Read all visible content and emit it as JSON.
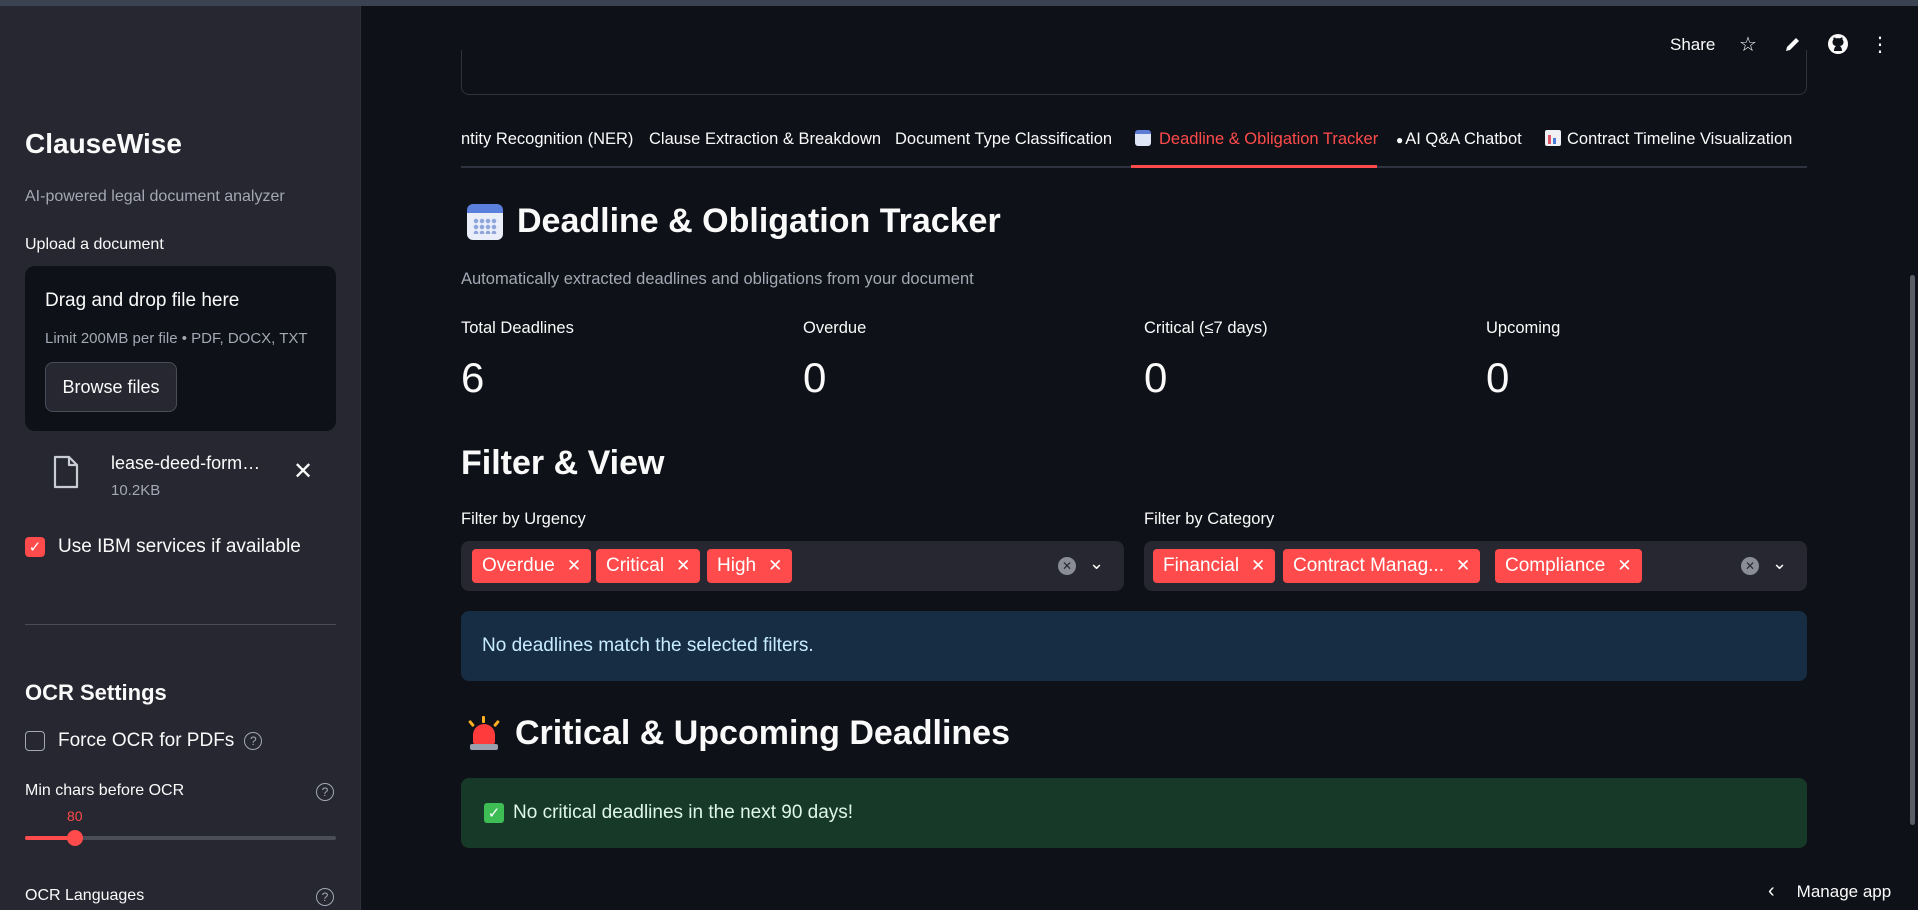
{
  "sidebar": {
    "app_title": "ClauseWise",
    "app_subtitle": "AI-powered legal document analyzer",
    "upload_label": "Upload a document",
    "dropzone": {
      "title": "Drag and drop file here",
      "limit": "Limit 200MB per file • PDF, DOCX, TXT",
      "browse_label": "Browse files"
    },
    "file": {
      "name": "lease-deed-format.docx",
      "size": "10.2KB"
    },
    "ibm_checkbox": {
      "label": "Use IBM services if available",
      "checked": true
    },
    "ocr": {
      "title": "OCR Settings",
      "force_label": "Force OCR for PDFs",
      "force_checked": false,
      "min_chars_label": "Min chars before OCR",
      "min_chars_value": "80",
      "min_chars_fraction": 0.16,
      "languages_label": "OCR Languages"
    }
  },
  "header": {
    "share_label": "Share",
    "icons": [
      "star-icon",
      "edit-icon",
      "github-icon",
      "more-icon"
    ]
  },
  "tabs": [
    {
      "label": "ntity Recognition (NER)"
    },
    {
      "label": "Clause Extraction & Breakdown"
    },
    {
      "label": "Document Type Classification"
    },
    {
      "label": "Deadline & Obligation Tracker",
      "active": true
    },
    {
      "label": "AI Q&A Chatbot"
    },
    {
      "label": "Contract Timeline Visualization"
    }
  ],
  "main": {
    "title": "Deadline & Obligation Tracker",
    "subtitle": "Automatically extracted deadlines and obligations from your document",
    "metrics": [
      {
        "label": "Total Deadlines",
        "value": "6"
      },
      {
        "label": "Overdue",
        "value": "0"
      },
      {
        "label": "Critical (≤7 days)",
        "value": "0"
      },
      {
        "label": "Upcoming",
        "value": "0"
      }
    ],
    "filter_title": "Filter & View",
    "urgency": {
      "label": "Filter by Urgency",
      "chips": [
        "Overdue",
        "Critical",
        "High"
      ]
    },
    "category": {
      "label": "Filter by Category",
      "chips": [
        "Financial",
        "Contract Manag...",
        "Compliance"
      ]
    },
    "info_message": "No deadlines match the selected filters.",
    "critical_title": "Critical & Upcoming Deadlines",
    "success_message": "No critical deadlines in the next 90 days!"
  },
  "footer": {
    "manage_app": "Manage app"
  },
  "colors": {
    "accent": "#ff4b4b",
    "background": "#0e1117",
    "sidebar": "#262730",
    "info_bg": "#172d43",
    "success_bg": "#173928"
  }
}
